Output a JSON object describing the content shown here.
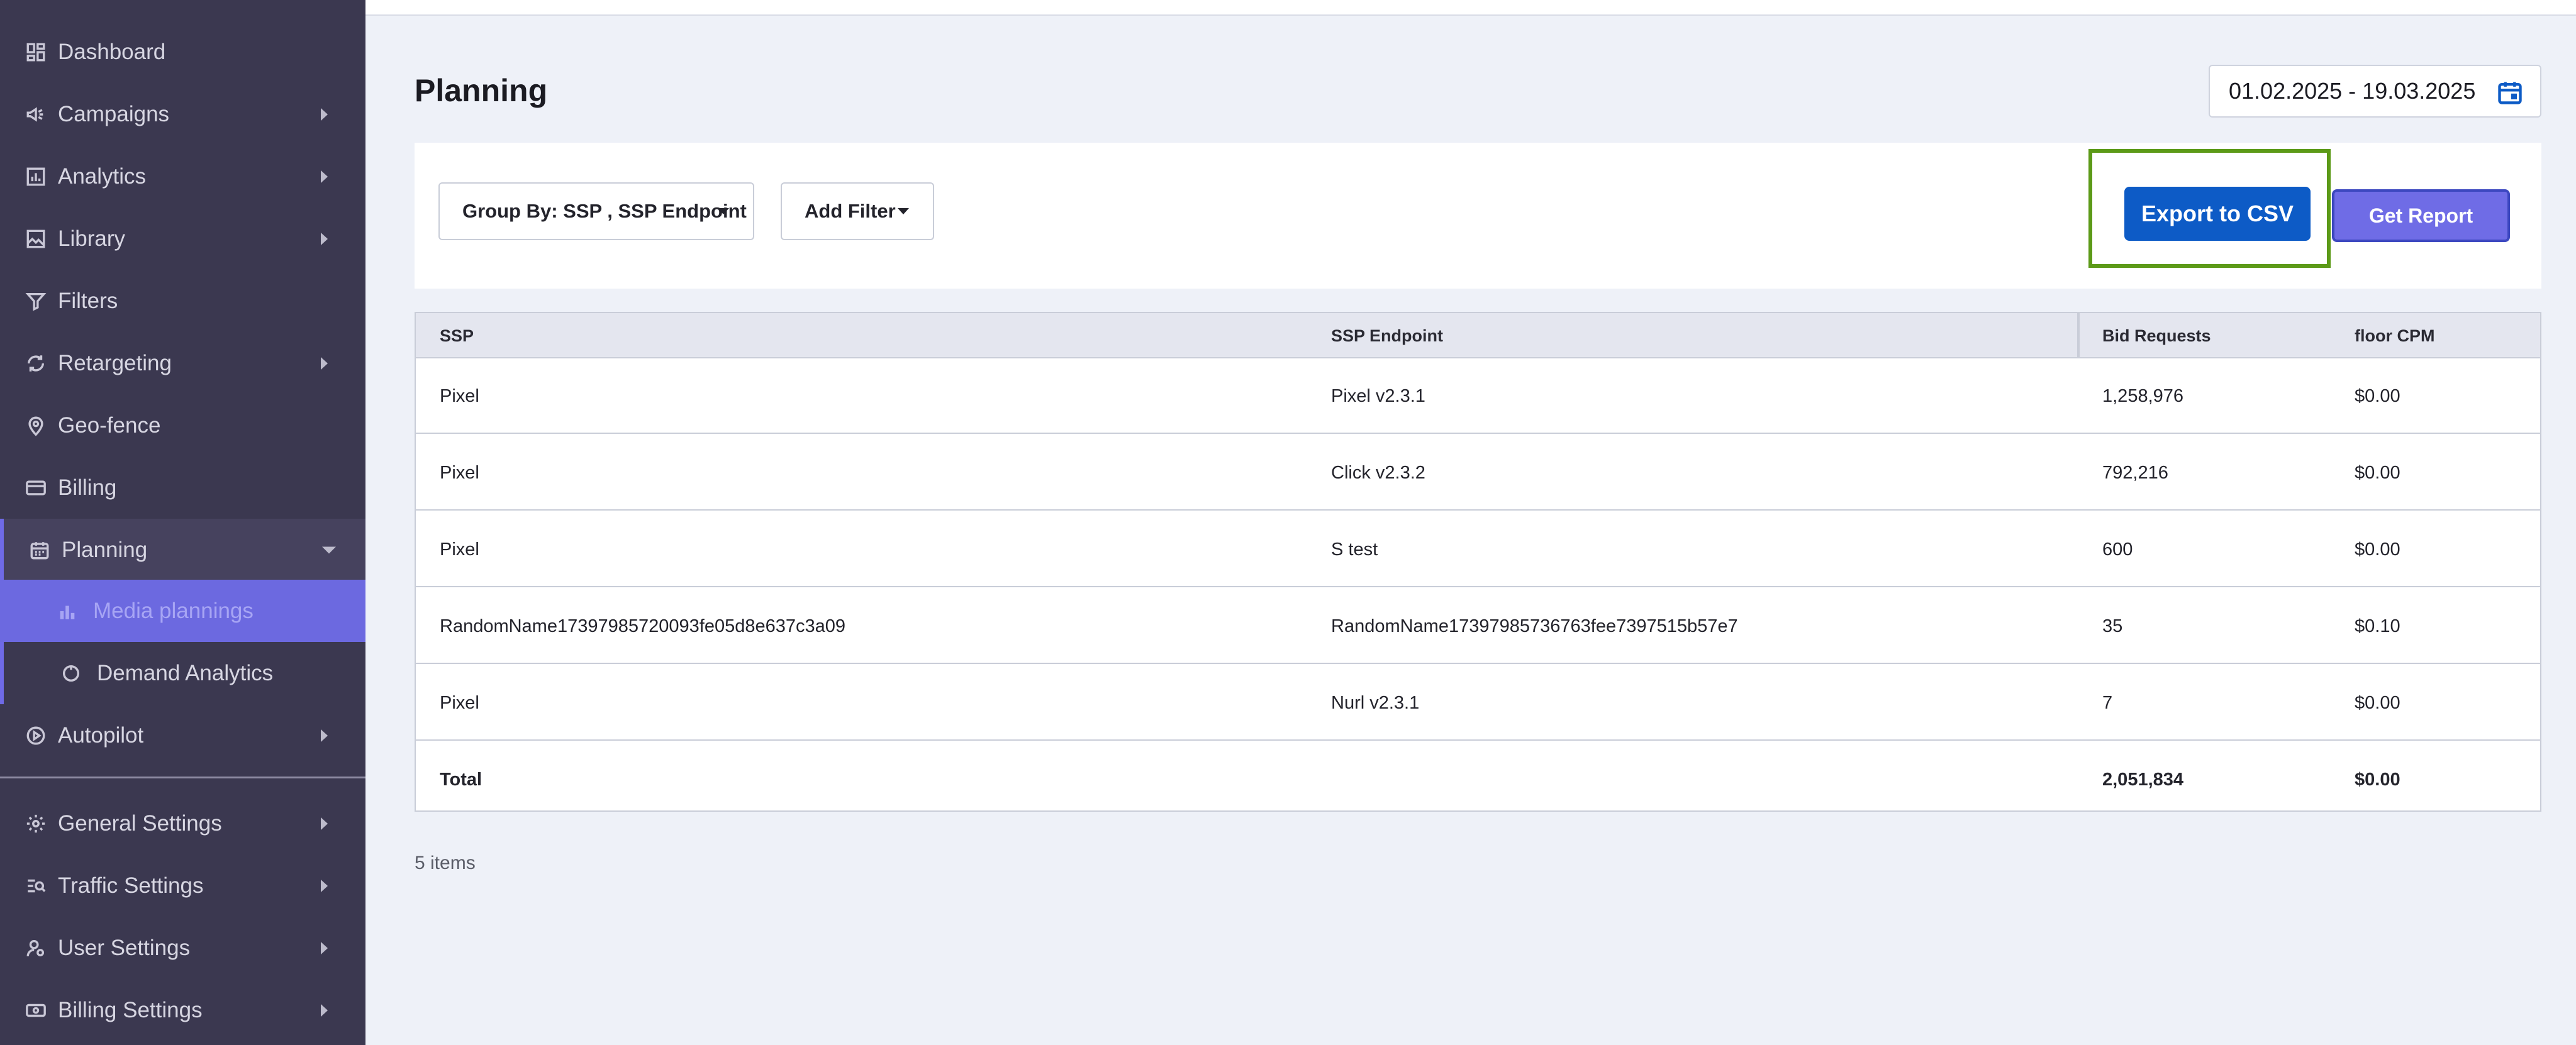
{
  "sidebar": {
    "items": [
      {
        "label": "Dashboard",
        "icon": "dashboard-icon"
      },
      {
        "label": "Campaigns",
        "icon": "megaphone-icon"
      },
      {
        "label": "Analytics",
        "icon": "bar-chart-icon"
      },
      {
        "label": "Library",
        "icon": "image-icon"
      },
      {
        "label": "Filters",
        "icon": "filter-icon"
      },
      {
        "label": "Retargeting",
        "icon": "refresh-icon"
      },
      {
        "label": "Geo-fence",
        "icon": "location-pin-icon"
      },
      {
        "label": "Billing",
        "icon": "credit-card-icon"
      },
      {
        "label": "Planning",
        "icon": "calendar-icon"
      },
      {
        "label": "Media plannings",
        "icon": "column-chart-icon"
      },
      {
        "label": "Demand Analytics",
        "icon": "donut-chart-icon"
      },
      {
        "label": "Autopilot",
        "icon": "play-circle-icon"
      },
      {
        "label": "General Settings",
        "icon": "gear-icon"
      },
      {
        "label": "Traffic Settings",
        "icon": "traffic-search-icon"
      },
      {
        "label": "User Settings",
        "icon": "user-settings-icon"
      },
      {
        "label": "Billing Settings",
        "icon": "billing-settings-icon"
      }
    ],
    "active_item": "Planning",
    "active_subitem": "Media plannings"
  },
  "header": {
    "title": "Planning",
    "date_range": "01.02.2025 - 19.03.2025"
  },
  "filters": {
    "group_by_label": "Group By: SSP , SSP Endpoint",
    "add_filter_label": "Add Filter",
    "export_label": "Export to CSV",
    "report_label": "Get Report"
  },
  "table": {
    "columns": [
      "SSP",
      "SSP Endpoint",
      "Bid Requests",
      "floor CPM"
    ],
    "rows": [
      {
        "ssp": "Pixel",
        "endpoint": "Pixel v2.3.1",
        "bid_requests": "1,258,976",
        "floor_cpm": "$0.00"
      },
      {
        "ssp": "Pixel",
        "endpoint": "Click v2.3.2",
        "bid_requests": "792,216",
        "floor_cpm": "$0.00"
      },
      {
        "ssp": "Pixel",
        "endpoint": "S test",
        "bid_requests": "600",
        "floor_cpm": "$0.00"
      },
      {
        "ssp": "RandomName17397985720093fe05d8e637c3a09",
        "endpoint": "RandomName17397985736763fee7397515b57e7",
        "bid_requests": "35",
        "floor_cpm": "$0.10"
      },
      {
        "ssp": "Pixel",
        "endpoint": "Nurl v2.3.1",
        "bid_requests": "7",
        "floor_cpm": "$0.00"
      }
    ],
    "total": {
      "label": "Total",
      "bid_requests": "2,051,834",
      "floor_cpm": "$0.00"
    }
  },
  "footer": {
    "items_count": "5 items"
  },
  "colors": {
    "sidebar_bg": "#3b3850",
    "accent": "#6c69e0",
    "export_button": "#0d5bc6",
    "highlight_border": "#5c9a18"
  }
}
